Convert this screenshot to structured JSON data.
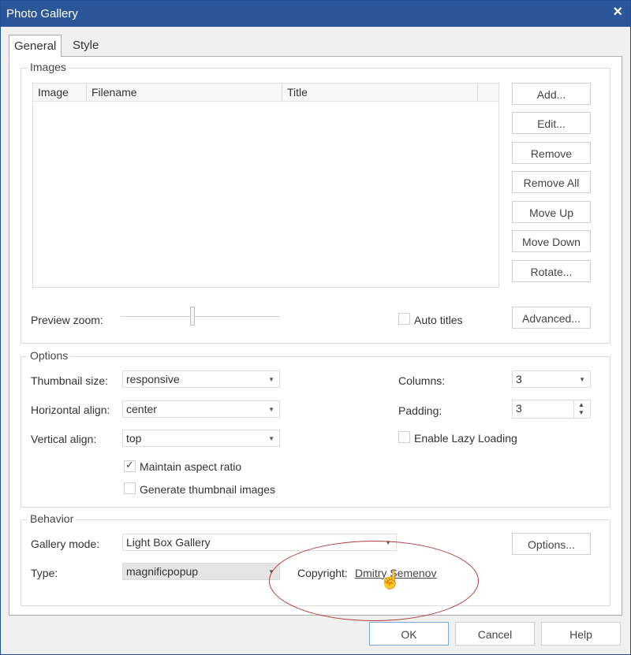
{
  "window": {
    "title": "Photo Gallery",
    "close_icon": "×"
  },
  "tabs": [
    {
      "label": "General"
    },
    {
      "label": "Style"
    }
  ],
  "images_group": {
    "title": "Images",
    "columns": [
      "Image",
      "Filename",
      "Title"
    ],
    "buttons": {
      "add": "Add...",
      "edit": "Edit...",
      "remove": "Remove",
      "remove_all": "Remove All",
      "move_up": "Move Up",
      "move_down": "Move Down",
      "rotate": "Rotate..."
    },
    "preview_zoom_label": "Preview zoom:",
    "preview_zoom_value": 0.45,
    "auto_titles_label": "Auto titles",
    "auto_titles_checked": false,
    "advanced_button": "Advanced..."
  },
  "options_group": {
    "title": "Options",
    "thumbnail_size_label": "Thumbnail size:",
    "thumbnail_size_value": "responsive",
    "horizontal_align_label": "Horizontal align:",
    "horizontal_align_value": "center",
    "vertical_align_label": "Vertical align:",
    "vertical_align_value": "top",
    "maintain_aspect_label": "Maintain aspect ratio",
    "maintain_aspect_checked": true,
    "generate_thumbs_label": "Generate thumbnail images",
    "generate_thumbs_checked": false,
    "columns_label": "Columns:",
    "columns_value": "3",
    "padding_label": "Padding:",
    "padding_value": "3",
    "lazy_loading_label": "Enable Lazy Loading",
    "lazy_loading_checked": false
  },
  "behavior_group": {
    "title": "Behavior",
    "gallery_mode_label": "Gallery mode:",
    "gallery_mode_value": "Light Box Gallery",
    "type_label": "Type:",
    "type_value": "magnificpopup",
    "options_button": "Options...",
    "copyright_label": "Copyright:",
    "copyright_link": "Dmitry Semenov"
  },
  "footer": {
    "ok": "OK",
    "cancel": "Cancel",
    "help": "Help"
  },
  "colors": {
    "titlebar": "#2b579a",
    "annotation_ellipse": "#b33a3a"
  }
}
